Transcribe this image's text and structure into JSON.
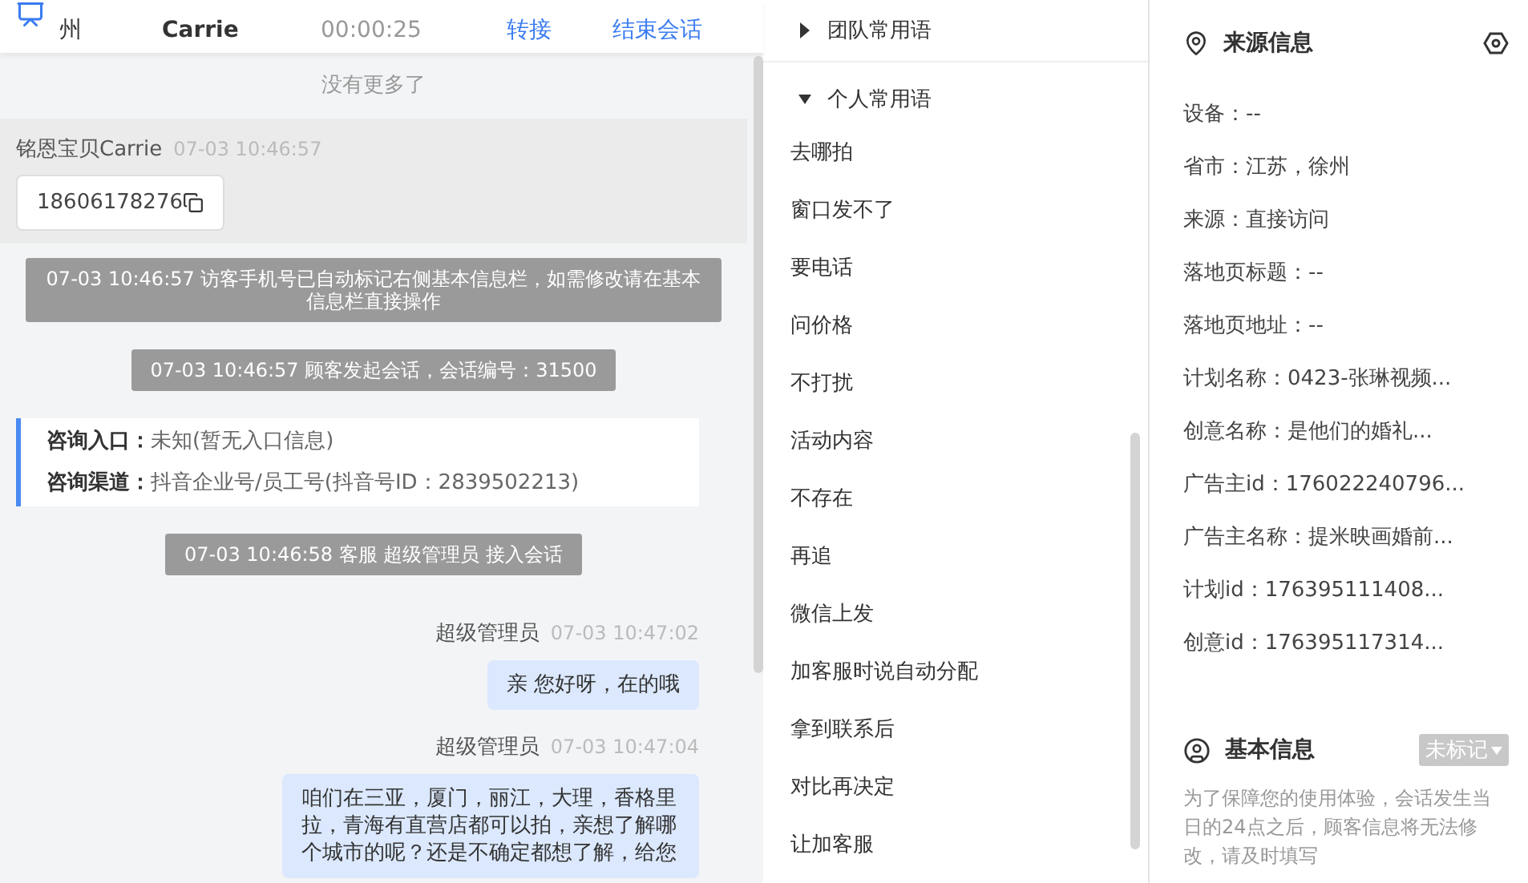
{
  "header": {
    "location": "州",
    "name": "Carrie",
    "timer": "00:00:25",
    "actions": [
      {
        "label": "转接"
      },
      {
        "label": "结束会话"
      }
    ]
  },
  "chat": {
    "no_more": "没有更多了",
    "messages": [
      {
        "kind": "visitor",
        "sender": "铭恩宝贝Carrie",
        "time": "07-03 10:46:57",
        "text": "18606178276"
      },
      {
        "kind": "system",
        "text": "07-03 10:46:57 访客手机号已自动标记右侧基本信息栏，如需修改请在基本信息栏直接操作"
      },
      {
        "kind": "system",
        "text": "07-03 10:46:57 顾客发起会话，会话编号：31500"
      },
      {
        "kind": "info",
        "rows": [
          {
            "label": "咨询入口：",
            "value": "未知(暂无入口信息)"
          },
          {
            "label": "咨询渠道：",
            "value": "抖音企业号/员工号(抖音号ID：2839502213)"
          }
        ]
      },
      {
        "kind": "system",
        "text": "07-03 10:46:58 客服 超级管理员 接入会话"
      },
      {
        "kind": "agent",
        "sender": "超级管理员",
        "time": "07-03 10:47:02",
        "text": "亲 您好呀，在的哦"
      },
      {
        "kind": "agent",
        "sender": "超级管理员",
        "time": "07-03 10:47:04",
        "text": "咱们在三亚，厦门，丽江，大理，香格里拉，青海有直营店都可以拍，亲想了解哪个城市的呢？还是不确定都想了解，给您"
      }
    ]
  },
  "phrases": {
    "groups": [
      {
        "title": "团队常用语",
        "expanded": false
      },
      {
        "title": "个人常用语",
        "expanded": true,
        "items": [
          "去哪拍",
          "窗口发不了",
          "要电话",
          "问价格",
          "不打扰",
          "活动内容",
          "不存在",
          "再追",
          "微信上发",
          "加客服时说自动分配",
          "拿到联系后",
          "对比再决定",
          "让加客服"
        ]
      }
    ]
  },
  "source_info": {
    "title": "来源信息",
    "fields": [
      "设备：--",
      "省市：江苏，徐州",
      "来源：直接访问",
      "落地页标题：--",
      "落地页地址：--",
      "计划名称：0423-张琳视频...",
      "创意名称：是他们的婚礼...",
      "广告主id：176022240796...",
      "广告主名称：提米映画婚前...",
      "计划id：176395111408...",
      "创意id：176395117314..."
    ]
  },
  "basic_info": {
    "title": "基本信息",
    "tag": "未标记",
    "note": "为了保障您的使用体验，会话发生当日的24点之后，顾客信息将无法修改，请及时填写"
  }
}
